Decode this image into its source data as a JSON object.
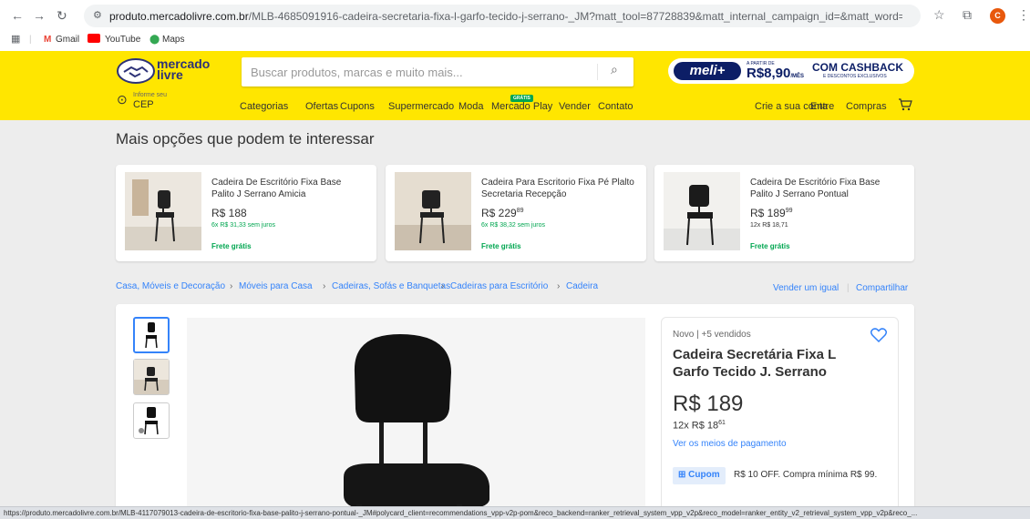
{
  "browser": {
    "url_host": "produto.mercadolivre.com.br",
    "url_path": "/MLB-4685091916-cadeira-secretaria-fixa-l-garfo-tecido-j-serrano-_JM?matt_tool=87728839&matt_internal_campaign_id=&matt_word=&matt_source=google&...",
    "profile_letter": "C",
    "bookmarks": [
      "Gmail",
      "YouTube",
      "Maps"
    ]
  },
  "header": {
    "logo_line1": "mercado",
    "logo_line2": "livre",
    "search_placeholder": "Buscar produtos, marcas e muito mais...",
    "location_line1": "Informe seu",
    "location_line2": "CEP",
    "meli_brand": "meli+",
    "meli_prefix": "A PARTIR DE",
    "meli_price": "R$8,90",
    "meli_period": "/MÊS",
    "meli_cashback": "COM CASHBACK",
    "meli_sub": "E DESCONTOS EXCLUSIVOS",
    "menu": [
      "Categorias",
      "Ofertas",
      "Cupons",
      "Supermercado",
      "Moda",
      "Mercado Play",
      "Vender",
      "Contato"
    ],
    "gratis_tag": "GRÁTIS",
    "account": [
      "Crie a sua conta",
      "Entre",
      "Compras"
    ]
  },
  "recommendations": {
    "heading": "Mais opções que podem te interessar",
    "items": [
      {
        "title": "Cadeira De Escritório Fixa Base Palito J Serrano Amicia",
        "price": "R$ 188",
        "cents": "",
        "installments": "6x R$ 31,33 sem juros",
        "shipping": "Frete grátis"
      },
      {
        "title": "Cadeira Para Escritorio Fixa Pé Plalto Secretaria Recepção",
        "price": "R$ 229",
        "cents": "89",
        "installments": "6x R$ 38,32 sem juros",
        "shipping": "Frete grátis"
      },
      {
        "title": "Cadeira De Escritório Fixa Base Palito J Serrano Pontual",
        "price": "R$ 189",
        "cents": "99",
        "installments": "12x R$ 18,71",
        "shipping": "Frete grátis"
      }
    ]
  },
  "breadcrumb": [
    "Casa, Móveis e Decoração",
    "Móveis para Casa",
    "Cadeiras, Sofás e Banquetas",
    "Cadeiras para Escritório",
    "Cadeira"
  ],
  "breadcrumb_actions": {
    "sell": "Vender um igual",
    "share": "Compartilhar"
  },
  "product": {
    "condition": "Novo  |  +5 vendidos",
    "title": "Cadeira Secretária Fixa L Garfo Tecido J. Serrano",
    "price": "R$ 189",
    "installments": "12x R$ 18",
    "installments_cents": "61",
    "payment_link": "Ver os meios de pagamento",
    "coupon_label": "Cupom",
    "coupon_text": "R$ 10 OFF. Compra mínima R$ 99."
  },
  "status_bar": "https://produto.mercadolivre.com.br/MLB-4117079013-cadeira-de-escritorio-fixa-base-palito-j-serrano-pontual-_JM#polycard_client=recommendations_vpp-v2p-pom&reco_backend=ranker_retrieval_system_vpp_v2p&reco_model=ranker_entity_v2_retrieval_system_vpp_v2p&reco_..."
}
